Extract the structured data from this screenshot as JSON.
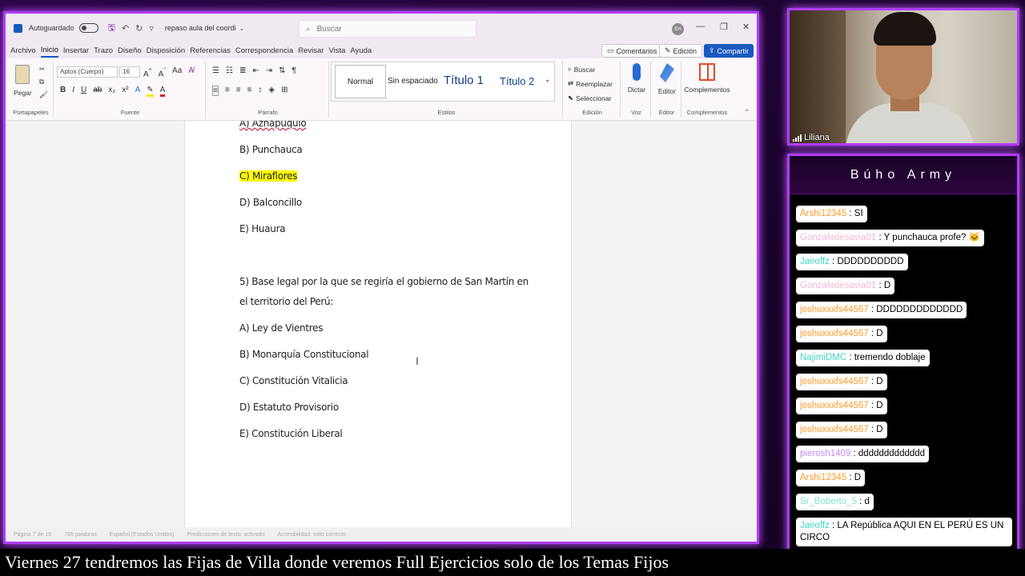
{
  "word": {
    "titlebar": {
      "autosave_label": "Autoguardado",
      "doc_name": "repaso aula del coordi",
      "search_placeholder": "Buscar",
      "avatar_initials": "EH"
    },
    "menu_tabs": [
      "Archivo",
      "Inicio",
      "Insertar",
      "Trazo",
      "Diseño",
      "Disposición",
      "Referencias",
      "Correspondencia",
      "Revisar",
      "Vista",
      "Ayuda"
    ],
    "active_tab": "Inicio",
    "comments_label": "Comentarios",
    "editing_label": "Edición",
    "share_label": "Compartir",
    "ribbon": {
      "paste_label": "Pegar",
      "font_name": "Aptos (Cuerpo)",
      "font_size": "16",
      "group_clipboard": "Portapapeles",
      "group_font": "Fuente",
      "group_paragraph": "Párrafo",
      "group_styles": "Estilos",
      "group_editing": "Edición",
      "group_voice": "Voz",
      "group_editor": "Editor",
      "group_addins": "Complementos",
      "style_normal": "Normal",
      "style_no_spacing": "Sin espaciado",
      "style_title1": "Título 1",
      "style_title2": "Título 2",
      "find_label": "Buscar",
      "replace_label": "Reemplazar",
      "select_label": "Seleccionar",
      "dictate_label": "Dictar",
      "editor_label": "Editor",
      "addins_label": "Complementos"
    },
    "document": {
      "q4_options": [
        "A) Aznapuquio",
        "B) Punchauca",
        "C) Miraflores",
        "D) Balconcillo",
        "E) Huaura"
      ],
      "q5_line1": "5) Base legal por la que se regiría el gobierno de San Martín en",
      "q5_line2": "el territorio del Perú:",
      "q5_options": [
        "A) Ley de Vientres",
        "B) Monarquía Constitucional",
        "C) Constitución Vitalicia",
        "D) Estatuto Provisorio",
        "E) Constitución Liberal"
      ]
    },
    "statusbar": [
      "Página 7 de 10",
      "785 palabras",
      "Español (Estados Unidos)",
      "Predicciones de texto: activado",
      "Accesibilidad: todo correcto"
    ]
  },
  "webcam": {
    "name": "Liliana"
  },
  "chat": {
    "title": "Búho Army",
    "colors": {
      "orange": "#ff9a2b",
      "pink": "#f2b8d4",
      "teal": "#3fd7c0",
      "lilac": "#c58bf0"
    },
    "messages": [
      {
        "user": "Arshi12345",
        "text": ": SI",
        "color": "#ff9a2b"
      },
      {
        "user": "Gonzalodesavia01",
        "text": ": Y punchauca profe? 🐱",
        "color": "#f2b8d4"
      },
      {
        "user": "Jairoffz",
        "text": ": DDDDDDDDDD",
        "color": "#3fd7c0"
      },
      {
        "user": "Gonzalodesavia01",
        "text": ": D",
        "color": "#f2b8d4"
      },
      {
        "user": "joshuxxxfs44567",
        "text": ": DDDDDDDDDDDDD",
        "color": "#ff9a2b"
      },
      {
        "user": "joshuxxxfs44567",
        "text": ": D",
        "color": "#ff9a2b"
      },
      {
        "user": "NajimiDMC",
        "text": ": tremendo doblaje",
        "color": "#3fd7c0"
      },
      {
        "user": "joshuxxxfs44567",
        "text": ": D",
        "color": "#ff9a2b"
      },
      {
        "user": "joshuxxxfs44567",
        "text": ": D",
        "color": "#ff9a2b"
      },
      {
        "user": "joshuxxxfs44567",
        "text": ": D",
        "color": "#ff9a2b"
      },
      {
        "user": "pierosh1409",
        "text": ": ddddddddddddd",
        "color": "#c58bf0"
      },
      {
        "user": "Arshi12345",
        "text": ": D",
        "color": "#ff9a2b"
      },
      {
        "user": "Sr_Boberto_5",
        "text": ": d",
        "color": "#7fe3cf"
      },
      {
        "user": "Jairoffz",
        "text": ": LA República AQUI EN EL PERÚ ES UN CIRCO",
        "color": "#3fd7c0"
      }
    ]
  },
  "ticker": "Viernes 27 tendremos las Fijas de Villa donde veremos Full Ejercicios solo de los Temas Fijos"
}
